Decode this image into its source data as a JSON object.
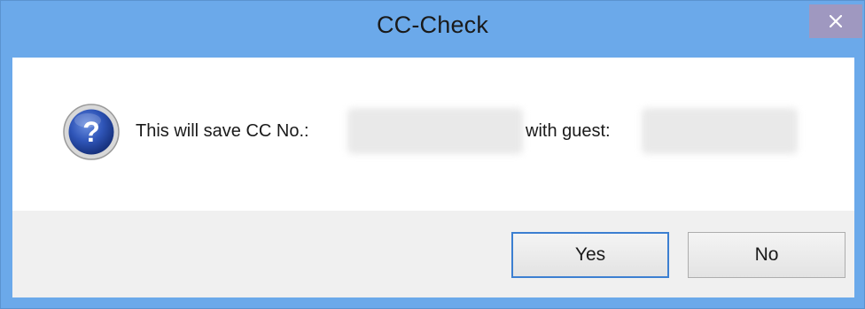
{
  "window": {
    "title": "CC-Check",
    "close_glyph": "×",
    "titlebar_color": "#6ba9ea"
  },
  "message": {
    "icon": "question-icon",
    "text_part1": "This will save CC No.:",
    "text_part2": "with guest:"
  },
  "buttons": {
    "yes_label": "Yes",
    "no_label": "No"
  }
}
